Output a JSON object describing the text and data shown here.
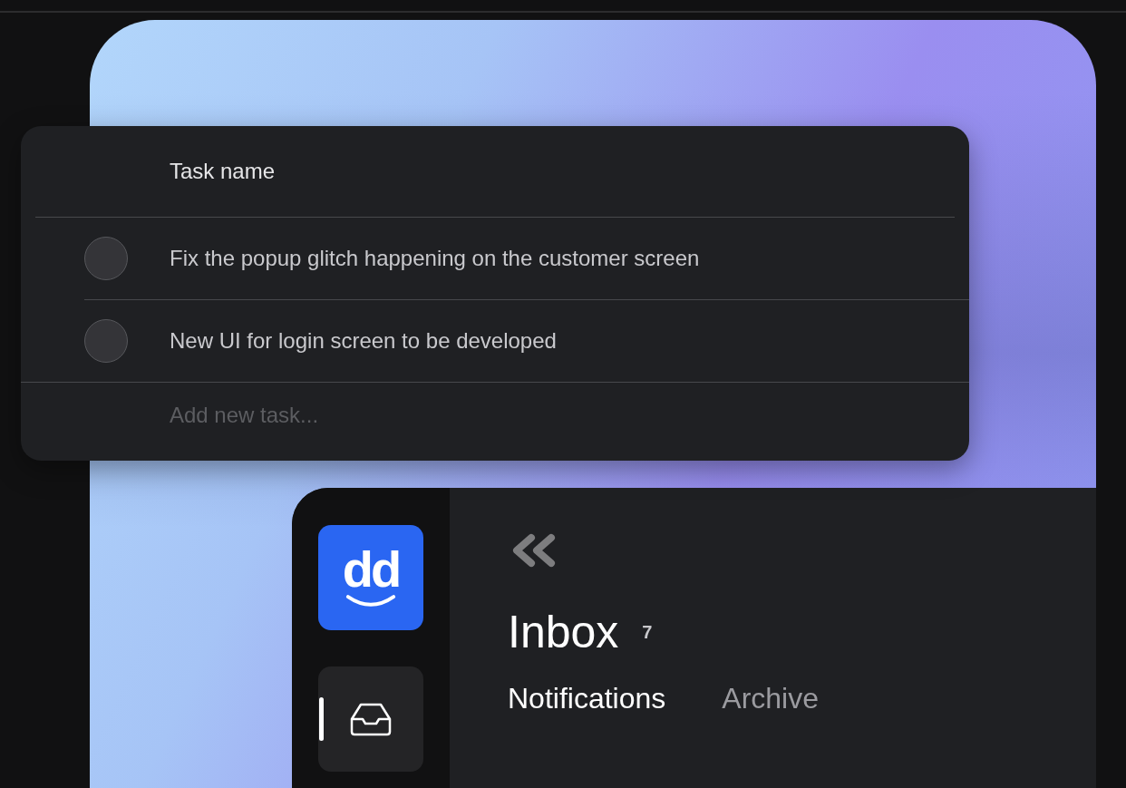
{
  "task_table": {
    "column_header": "Task name",
    "rows": [
      {
        "name": "Fix the popup glitch happening on the customer screen",
        "checked": false
      },
      {
        "name": "New UI for login screen to be developed",
        "checked": false
      }
    ],
    "new_task": {
      "placeholder": "Add new task..."
    }
  },
  "app": {
    "logo": "dd",
    "sidebar": [
      {
        "selected": true
      }
    ],
    "title": "Inbox",
    "count": "7",
    "tabs": [
      {
        "label": "Notifications",
        "selected": true
      },
      {
        "label": "Archive",
        "selected": false
      }
    ]
  }
}
